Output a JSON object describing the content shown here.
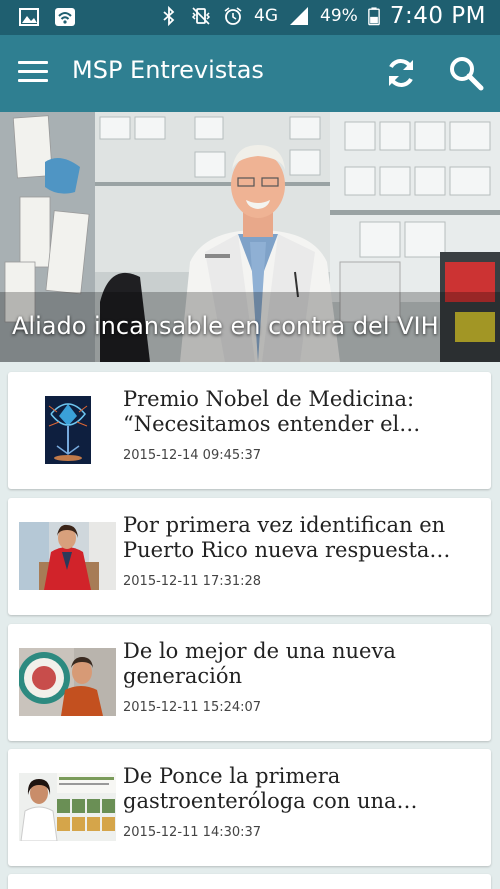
{
  "status_bar": {
    "battery_percent": "49%",
    "network": "4G",
    "time": "7:40 PM",
    "icons": [
      "image-icon",
      "wifi-icon",
      "bluetooth-icon",
      "vibrate-icon",
      "alarm-icon",
      "signal-icon",
      "battery-icon"
    ]
  },
  "app_bar": {
    "title": "MSP Entrevistas",
    "icons": [
      "menu-icon",
      "refresh-icon",
      "search-icon"
    ],
    "color": "#2f7f91"
  },
  "hero": {
    "caption": "Aliado incansable en contra del VIH"
  },
  "articles": [
    {
      "title_line1": "Premio Nobel de Medicina:",
      "title_line2": "“Necesitamos entender el…",
      "date": "2015-12-14 09:45:37"
    },
    {
      "title_line1": "Por primera vez identifican en",
      "title_line2": "Puerto Rico nueva respuesta…",
      "date": "2015-12-11 17:31:28"
    },
    {
      "title_line1": "De lo mejor de una nueva",
      "title_line2": "generación",
      "date": "2015-12-11 15:24:07"
    },
    {
      "title_line1": "De Ponce la primera",
      "title_line2": "gastroenteróloga con una…",
      "date": "2015-12-11 14:30:37"
    }
  ]
}
